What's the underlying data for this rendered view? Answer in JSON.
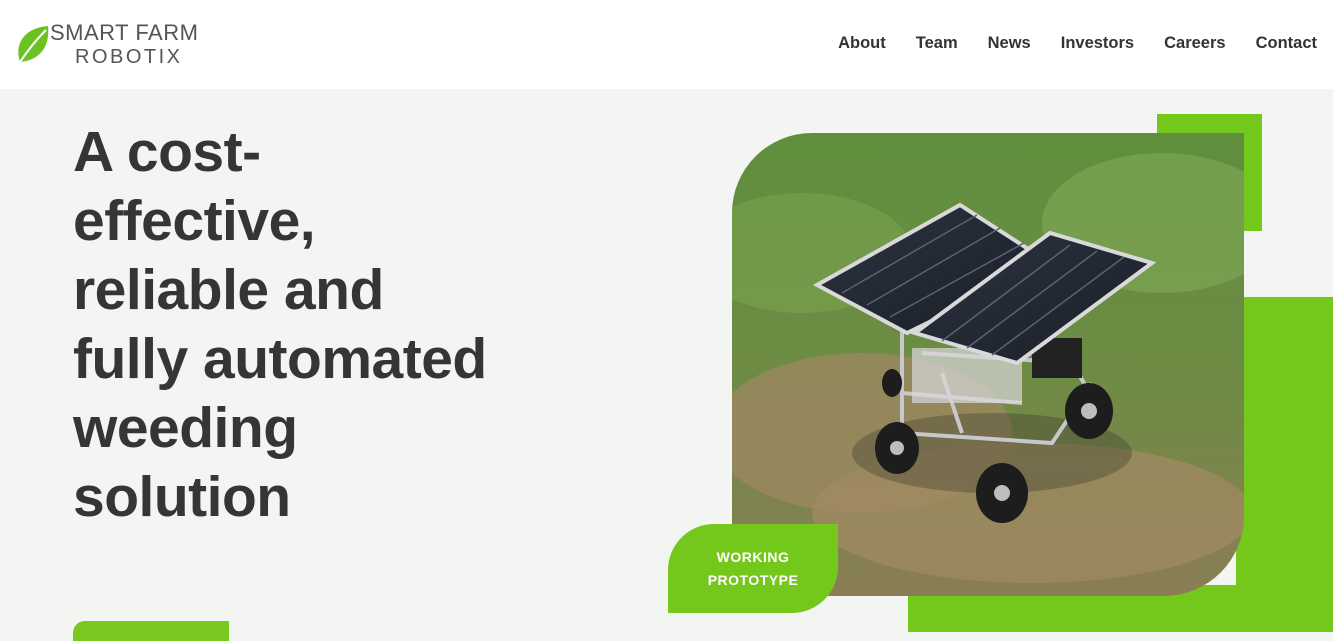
{
  "brand": {
    "line1": "SMART FARM",
    "line2": "ROBOTIX",
    "accent_color": "#e8534a",
    "leaf_color": "#6cc223"
  },
  "nav": {
    "items": [
      {
        "label": "About"
      },
      {
        "label": "Team"
      },
      {
        "label": "News"
      },
      {
        "label": "Investors"
      },
      {
        "label": "Careers"
      },
      {
        "label": "Contact"
      }
    ]
  },
  "hero": {
    "title": "A cost-effective, reliable and fully automated weeding solution",
    "badge_line1": "WORKING",
    "badge_line2": "PROTOTYPE"
  },
  "colors": {
    "green": "#74c81b",
    "text": "#353535",
    "background": "#f3f5f3"
  }
}
